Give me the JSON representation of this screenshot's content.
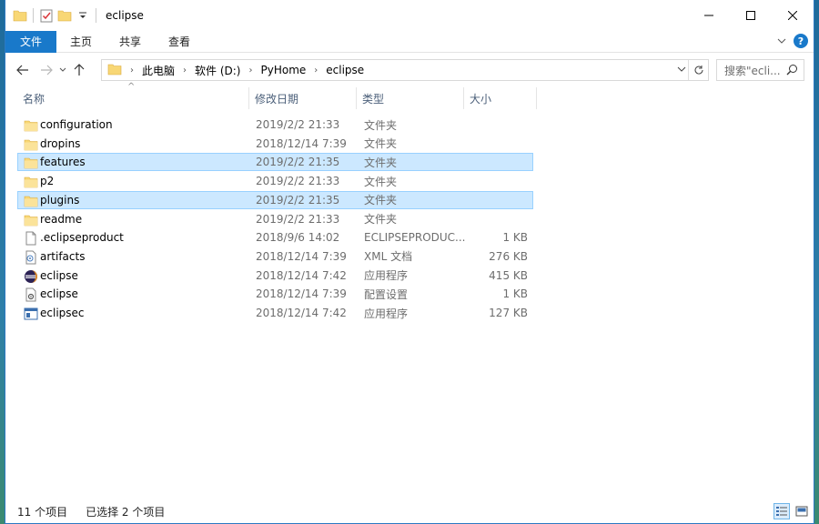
{
  "window": {
    "title": "eclipse"
  },
  "ribbon": {
    "tabs": [
      "文件",
      "主页",
      "共享",
      "查看"
    ]
  },
  "address": {
    "crumbs": [
      "此电脑",
      "软件 (D:)",
      "PyHome",
      "eclipse"
    ]
  },
  "search": {
    "placeholder": "搜索\"ecli..."
  },
  "columns": {
    "name": "名称",
    "date": "修改日期",
    "type": "类型",
    "size": "大小"
  },
  "files": [
    {
      "name": "configuration",
      "date": "2019/2/2 21:33",
      "type": "文件夹",
      "size": "",
      "icon": "folder-icon",
      "state": ""
    },
    {
      "name": "dropins",
      "date": "2018/12/14 7:39",
      "type": "文件夹",
      "size": "",
      "icon": "folder-icon",
      "state": ""
    },
    {
      "name": "features",
      "date": "2019/2/2 21:35",
      "type": "文件夹",
      "size": "",
      "icon": "folder-icon",
      "state": "selected-focus"
    },
    {
      "name": "p2",
      "date": "2019/2/2 21:33",
      "type": "文件夹",
      "size": "",
      "icon": "folder-icon",
      "state": ""
    },
    {
      "name": "plugins",
      "date": "2019/2/2 21:35",
      "type": "文件夹",
      "size": "",
      "icon": "folder-icon",
      "state": "selected"
    },
    {
      "name": "readme",
      "date": "2019/2/2 21:33",
      "type": "文件夹",
      "size": "",
      "icon": "folder-icon",
      "state": ""
    },
    {
      "name": ".eclipseproduct",
      "date": "2018/9/6 14:02",
      "type": "ECLIPSEPRODUC...",
      "size": "1 KB",
      "icon": "file-icon",
      "state": ""
    },
    {
      "name": "artifacts",
      "date": "2018/12/14 7:39",
      "type": "XML 文档",
      "size": "276 KB",
      "icon": "xml-file-icon",
      "state": ""
    },
    {
      "name": "eclipse",
      "date": "2018/12/14 7:42",
      "type": "应用程序",
      "size": "415 KB",
      "icon": "eclipse-app-icon",
      "state": ""
    },
    {
      "name": "eclipse",
      "date": "2018/12/14 7:39",
      "type": "配置设置",
      "size": "1 KB",
      "icon": "config-file-icon",
      "state": ""
    },
    {
      "name": "eclipsec",
      "date": "2018/12/14 7:42",
      "type": "应用程序",
      "size": "127 KB",
      "icon": "console-app-icon",
      "state": ""
    }
  ],
  "status": {
    "count": "11 个项目",
    "selected": "已选择 2 个项目"
  },
  "colors": {
    "accent": "#1979ca",
    "selection": "#cce8ff",
    "folder": "#f8d775"
  }
}
